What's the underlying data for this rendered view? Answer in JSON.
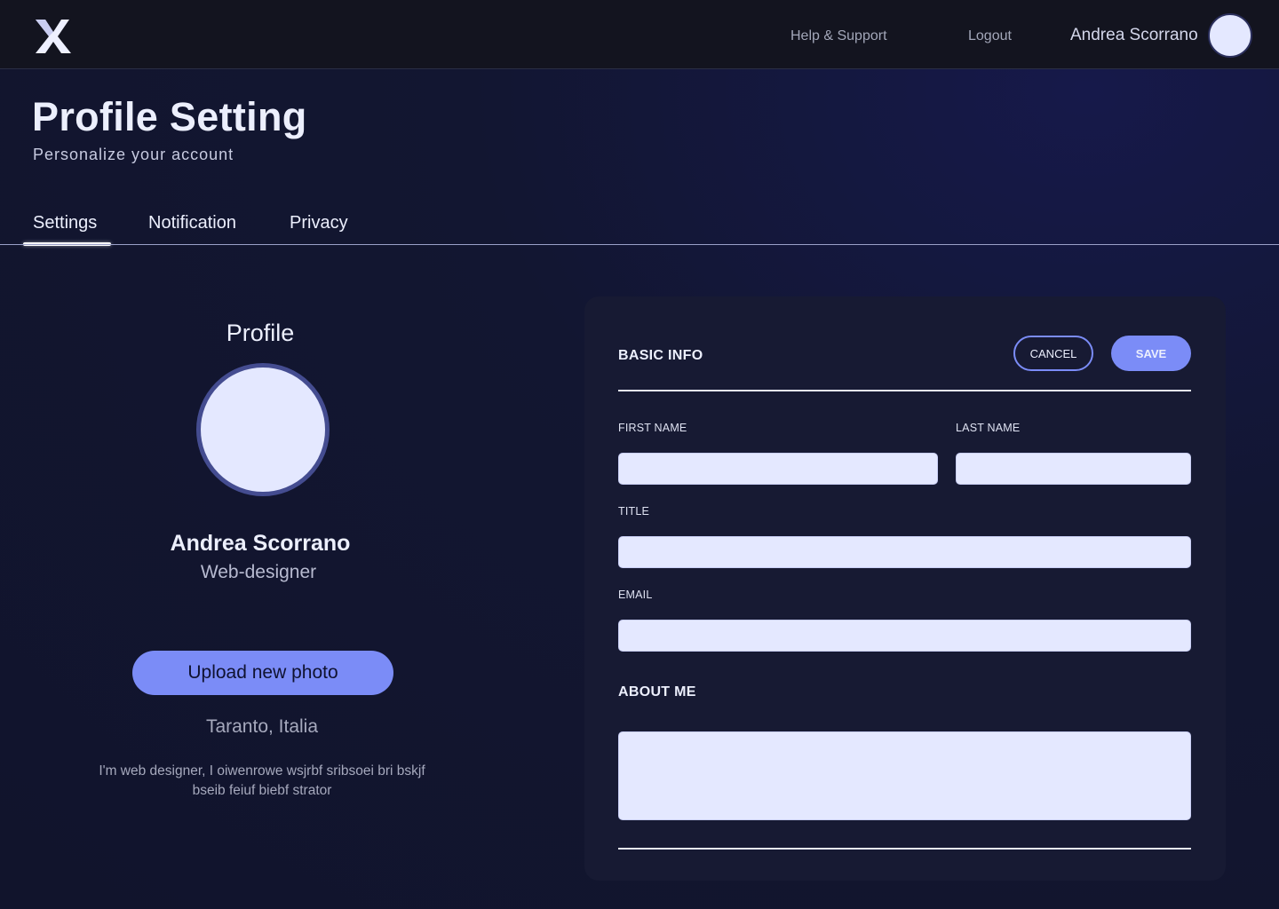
{
  "header": {
    "logo_icon": "x-logo-icon",
    "nav": {
      "help_label": "Help & Support",
      "logout_label": "Logout"
    },
    "user_name": "Andrea Scorrano"
  },
  "page": {
    "title": "Profile Setting",
    "subtitle": "Personalize your account"
  },
  "tabs": [
    {
      "label": "Settings",
      "active": true
    },
    {
      "label": "Notification",
      "active": false
    },
    {
      "label": "Privacy",
      "active": false
    }
  ],
  "profile": {
    "heading": "Profile",
    "name": "Andrea Scorrano",
    "role": "Web-designer",
    "upload_label": "Upload new photo",
    "location": "Taranto, Italia",
    "bio": "I'm web designer, I  oiwenrowe wsjrbf sribsoei bri bskjf bseib feiuf biebf strator"
  },
  "basic_info": {
    "heading": "BASIC INFO",
    "cancel_label": "CANCEL",
    "save_label": "SAVE",
    "fields": {
      "first_name": {
        "label": "FIRST NAME",
        "value": ""
      },
      "last_name": {
        "label": "LAST NAME",
        "value": ""
      },
      "title": {
        "label": "TITLE",
        "value": ""
      },
      "email": {
        "label": "EMAIL",
        "value": ""
      }
    },
    "about_heading": "ABOUT ME",
    "about_value": ""
  },
  "colors": {
    "background": "#121631",
    "topbar": "#13141f",
    "card": "#171a33",
    "accent": "#7b8cf7",
    "input": "#e4e8ff"
  }
}
